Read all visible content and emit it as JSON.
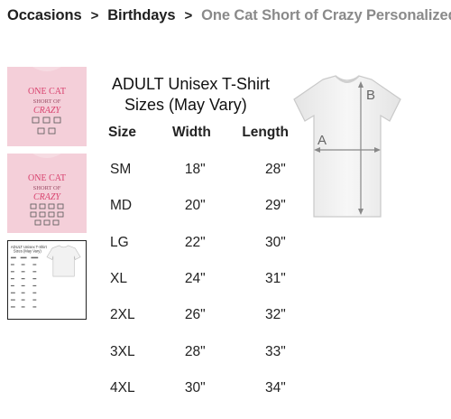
{
  "breadcrumb": {
    "items": [
      {
        "label": "Occasions"
      },
      {
        "label": "Birthdays"
      }
    ],
    "separator": ">",
    "current": "One Cat Short of Crazy Personalized"
  },
  "thumbnails": {
    "design_text": [
      "ONE CAT",
      "SHORT OF",
      "CRAZY"
    ],
    "shirt_color": "#f6dbe2",
    "accent_color": "#e0527c"
  },
  "size_chart": {
    "title_line1": "ADULT Unisex T-Shirt",
    "title_line2": "Sizes (May Vary)",
    "headers": {
      "size": "Size",
      "width": "Width",
      "length": "Length"
    },
    "rows": [
      {
        "size": "SM",
        "width": "18\"",
        "length": "28\""
      },
      {
        "size": "MD",
        "width": "20\"",
        "length": "29\""
      },
      {
        "size": "LG",
        "width": "22\"",
        "length": "30\""
      },
      {
        "size": "XL",
        "width": "24\"",
        "length": "31\""
      },
      {
        "size": "2XL",
        "width": "26\"",
        "length": "32\""
      },
      {
        "size": "3XL",
        "width": "28\"",
        "length": "33\""
      },
      {
        "size": "4XL",
        "width": "30\"",
        "length": "34\""
      }
    ],
    "diagram_labels": {
      "a": "A",
      "b": "B"
    }
  }
}
